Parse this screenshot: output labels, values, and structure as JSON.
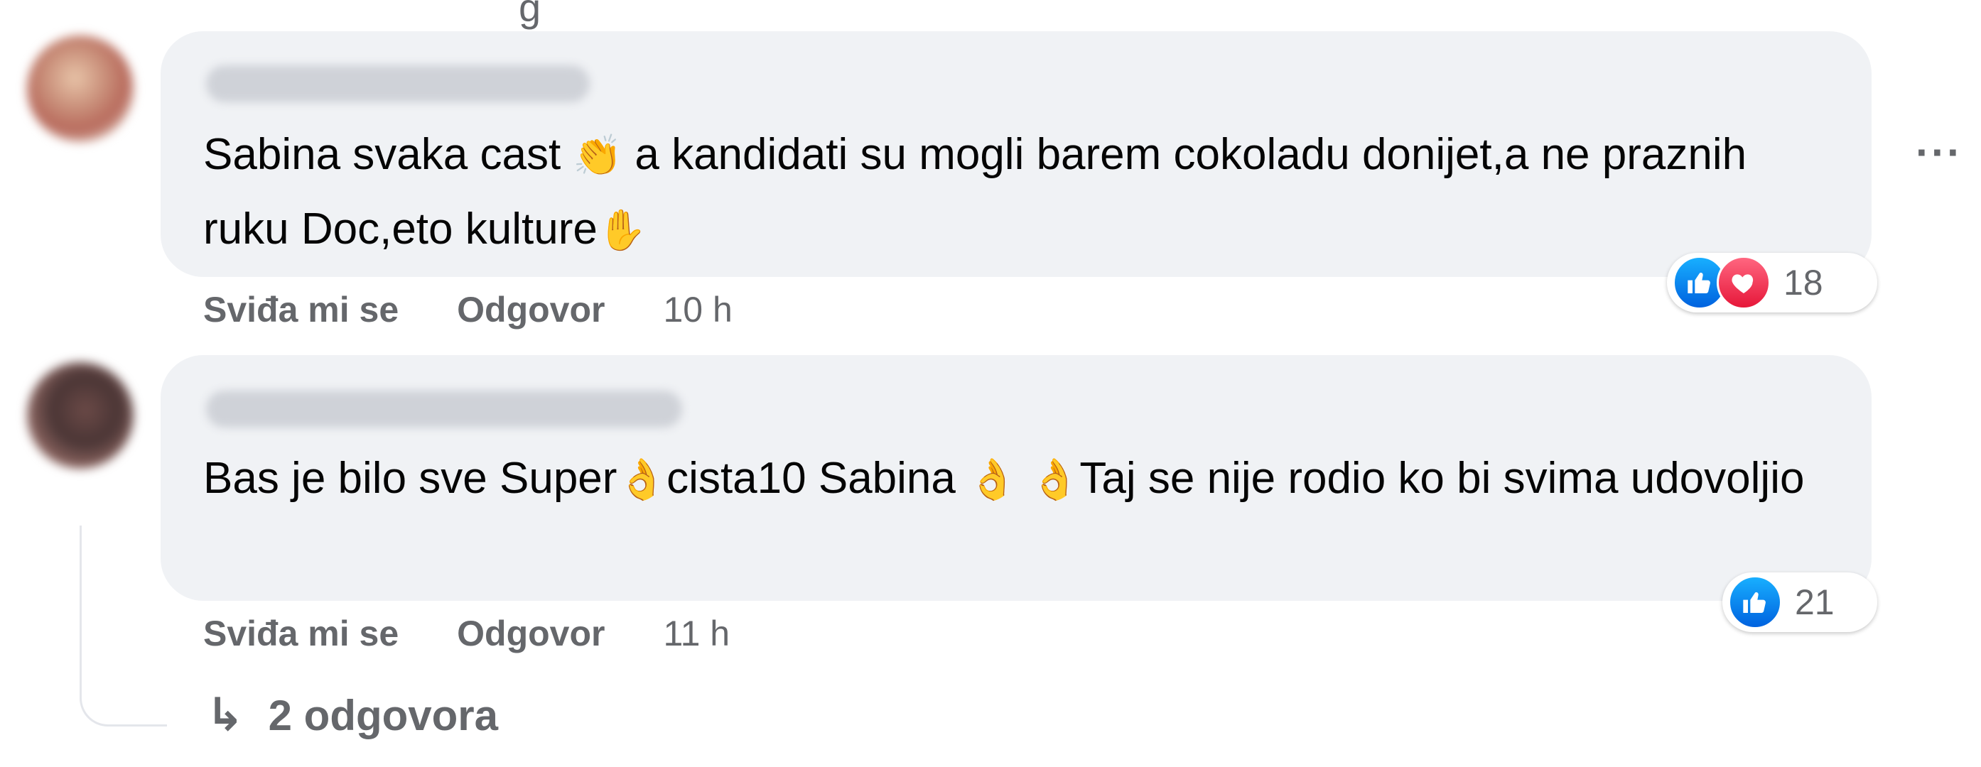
{
  "top_fragment": "g",
  "comments": [
    {
      "text_a": "Sabina svaka cast ",
      "emoji_a": "👏",
      "text_b": " a kandidati su mogli barem cokoladu donijet,a ne praznih ruku Doc,eto kulture",
      "emoji_b": "✋",
      "like_label": "Sviđa mi se",
      "reply_label": "Odgovor",
      "time": "10 h",
      "reactions": [
        "like",
        "love"
      ],
      "reaction_count": "18"
    },
    {
      "text_a": "Bas je bilo sve Super",
      "emoji_a": "👌",
      "text_b": "cista10 Sabina ",
      "emoji_b": "👌 👌",
      "text_c": "Taj se nije rodio ko bi svima udovoljio",
      "like_label": "Sviđa mi se",
      "reply_label": "Odgovor",
      "time": "11 h",
      "reactions": [
        "like"
      ],
      "reaction_count": "21"
    }
  ],
  "more_label": "···",
  "replies": {
    "arrow": "↳",
    "label": "2 odgovora"
  },
  "colors": {
    "bubble": "#f0f2f5",
    "secondary_text": "#65676b",
    "like": "#0a7cff",
    "love": "#f33e58"
  }
}
